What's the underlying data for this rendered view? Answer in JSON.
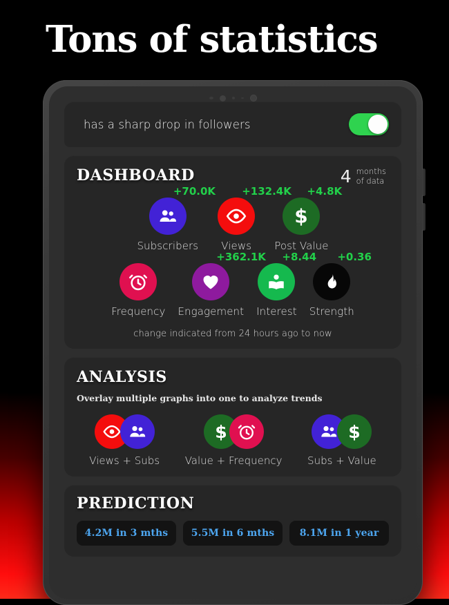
{
  "headline": "Tons of statistics",
  "toggle_card": {
    "label": "has a sharp drop in followers",
    "switch_state": "on",
    "switch_color": "#2fd34f"
  },
  "dashboard": {
    "title": "DASHBOARD",
    "months_number": "4",
    "months_label_line1": "months",
    "months_label_line2": "of data",
    "note": "change indicated from 24 hours ago to now",
    "delta_color": "#22d04a",
    "stats_row1": [
      {
        "label": "Subscribers",
        "delta": "+70.0K",
        "icon": "people-icon",
        "color": "#4222d6"
      },
      {
        "label": "Views",
        "delta": "+132.4K",
        "icon": "eye-icon",
        "color": "#f40d0d"
      },
      {
        "label": "Post Value",
        "delta": "+4.8K",
        "icon": "dollar-icon",
        "color": "#1d6b24"
      }
    ],
    "stats_row2": [
      {
        "label": "Frequency",
        "delta": "",
        "icon": "alarm-clock-icon",
        "color": "#e01050"
      },
      {
        "label": "Engagement",
        "delta": "+362.1K",
        "icon": "heart-icon",
        "color": "#8e1a9e"
      },
      {
        "label": "Interest",
        "delta": "+8.44",
        "icon": "reader-icon",
        "color": "#15b94e"
      },
      {
        "label": "Strength",
        "delta": "+0.36",
        "icon": "flame-icon",
        "color": "#070707"
      }
    ]
  },
  "analysis": {
    "title": "ANALYSIS",
    "subtitle": "Overlay multiple graphs into one to analyze trends",
    "pairs": [
      {
        "label": "Views + Subs",
        "icon_a": "eye-icon",
        "color_a": "#f40d0d",
        "icon_b": "people-icon",
        "color_b": "#4222d6"
      },
      {
        "label": "Value + Frequency",
        "icon_a": "dollar-icon",
        "color_a": "#1d6b24",
        "icon_b": "alarm-clock-icon",
        "color_b": "#e01050"
      },
      {
        "label": "Subs + Value",
        "icon_a": "people-icon",
        "color_a": "#4222d6",
        "icon_b": "dollar-icon",
        "color_b": "#1d6b24"
      }
    ]
  },
  "prediction": {
    "title": "PREDICTION",
    "chips": [
      {
        "label": "4.2M in 3 mths"
      },
      {
        "label": "5.5M in 6 mths"
      },
      {
        "label": "8.1M in 1 year"
      }
    ],
    "chip_text_color": "#4da6f0"
  }
}
